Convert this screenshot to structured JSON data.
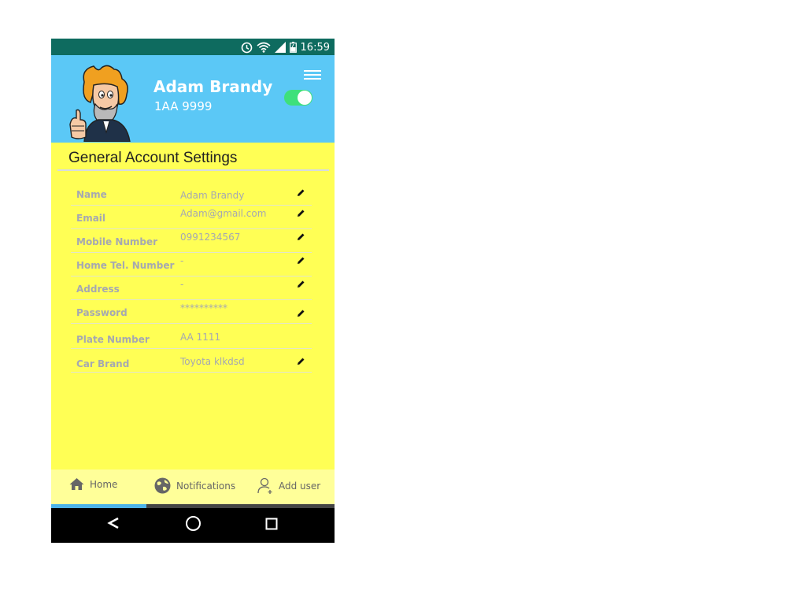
{
  "status_bar": {
    "time": "16:59",
    "icons": [
      "alarm-icon",
      "wifi-icon",
      "signal-icon",
      "battery-icon"
    ]
  },
  "profile": {
    "name": "Adam Brandy",
    "plate": "1AA 9999",
    "toggle_on": true
  },
  "settings": {
    "title": "General Account Settings",
    "rows": [
      {
        "label": "Name",
        "value": "Adam Brandy",
        "editable": true
      },
      {
        "label": "Email",
        "value": "Adam@gmail.com",
        "editable": true
      },
      {
        "label": "Mobile Number",
        "value": "0991234567",
        "editable": true
      },
      {
        "label": "Home Tel. Number",
        "value": "-",
        "editable": true
      },
      {
        "label": "Address",
        "value": "-",
        "editable": true
      },
      {
        "label": "Password",
        "value": "**********",
        "editable": true
      },
      {
        "label": "Plate Number",
        "value": "AA 1111",
        "editable": false
      },
      {
        "label": "Car Brand",
        "value": "Toyota klkdsd",
        "editable": true
      }
    ]
  },
  "bottom_nav": {
    "items": [
      {
        "label": "Home",
        "icon": "home-icon"
      },
      {
        "label": "Notifications",
        "icon": "globe-icon"
      },
      {
        "label": "Add user",
        "icon": "add-user-icon"
      }
    ],
    "active_index": 0
  },
  "colors": {
    "status_bar": "#0e6b5f",
    "header": "#5bc8f6",
    "background": "#ffff55",
    "bottom_nav": "#ffff99",
    "toggle": "#3ee07b",
    "indicator": "#4db3e8"
  }
}
